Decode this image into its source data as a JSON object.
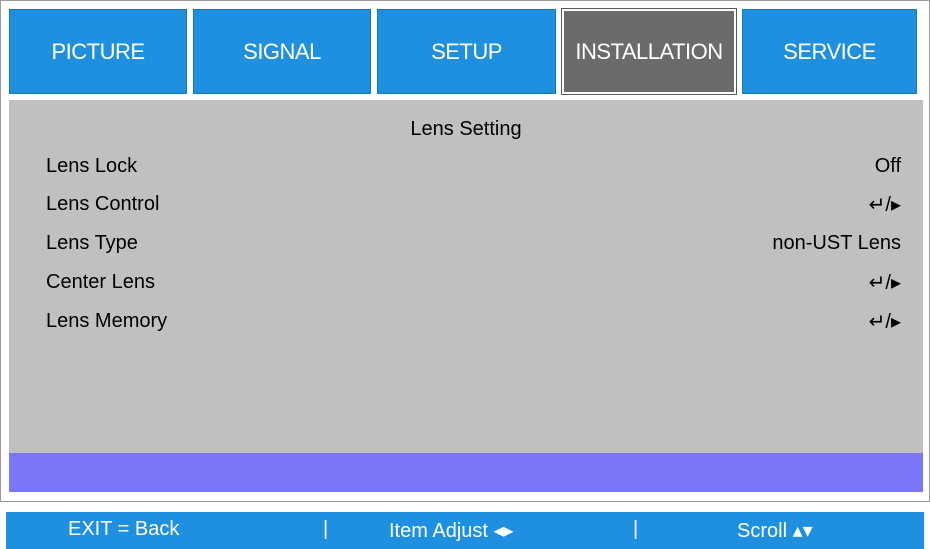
{
  "tabs": [
    {
      "label": "PICTURE"
    },
    {
      "label": "SIGNAL"
    },
    {
      "label": "SETUP"
    },
    {
      "label": "INSTALLATION",
      "active": true
    },
    {
      "label": "SERVICE"
    }
  ],
  "section_title": "Lens Setting",
  "items": [
    {
      "label": "Lens Lock",
      "value": "Off"
    },
    {
      "label": "Lens Control",
      "value": "↵/▸"
    },
    {
      "label": "Lens Type",
      "value": "non-UST Lens"
    },
    {
      "label": "Center Lens",
      "value": "↵/▸"
    },
    {
      "label": "Lens Memory",
      "value": "↵/▸"
    }
  ],
  "footer": {
    "exit": "EXIT = Back",
    "sep1": "|",
    "adjust": "Item Adjust ◂▸",
    "sep2": "|",
    "scroll": "Scroll ▴▾"
  },
  "colors": {
    "tab_blue": "#1f8fe0",
    "tab_active": "#6b6b6b",
    "content_bg": "#c0c0c0",
    "highlight": "#7b76f7"
  }
}
